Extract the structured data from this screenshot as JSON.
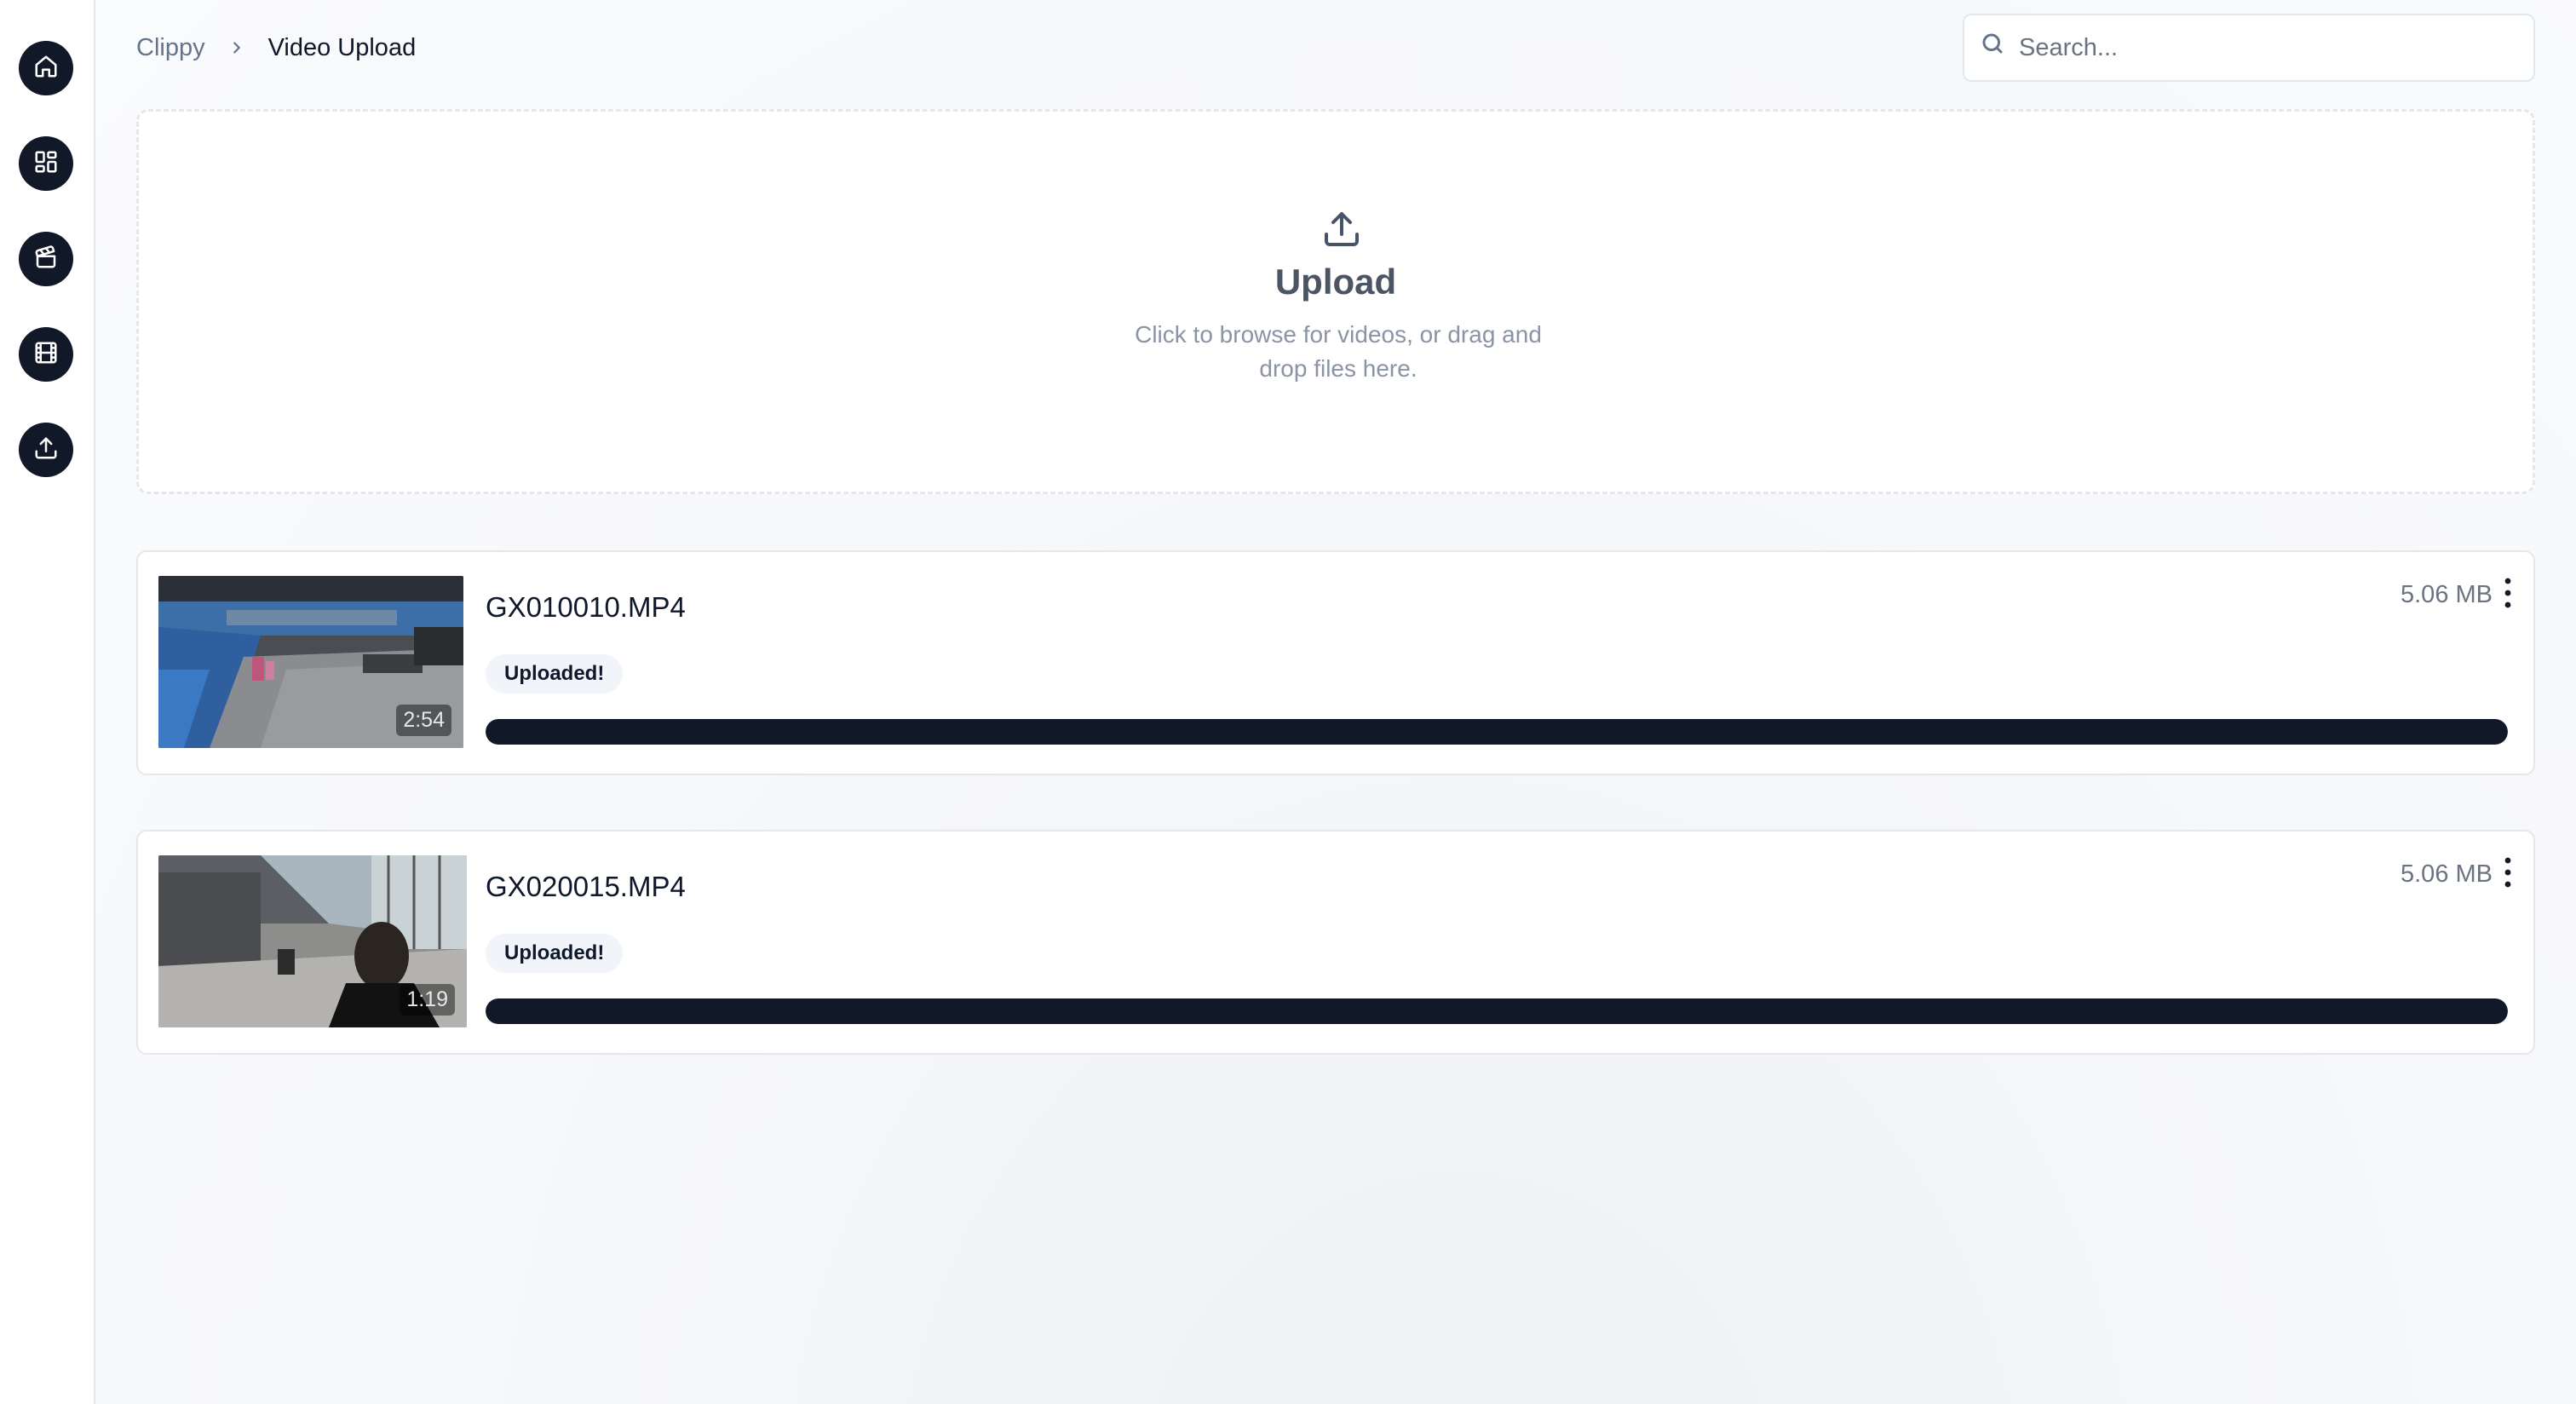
{
  "sidebar": {
    "items": [
      {
        "name": "home",
        "icon": "home-icon"
      },
      {
        "name": "dashboard",
        "icon": "layout-grid-icon"
      },
      {
        "name": "clapperboard",
        "icon": "clapperboard-icon"
      },
      {
        "name": "film",
        "icon": "film-icon"
      },
      {
        "name": "upload",
        "icon": "upload-icon"
      }
    ]
  },
  "breadcrumb": {
    "root": "Clippy",
    "separator_icon": "chevron-right-icon",
    "current": "Video Upload"
  },
  "search": {
    "placeholder": "Search...",
    "value": "",
    "icon": "search-icon"
  },
  "dropzone": {
    "icon": "upload-icon",
    "title": "Upload",
    "subtitle": "Click to browse for videos, or drag and drop files here."
  },
  "uploads": [
    {
      "filename": "GX010010.MP4",
      "duration": "2:54",
      "status": "Uploaded!",
      "size": "5.06 MB",
      "progress_percent": 100
    },
    {
      "filename": "GX020015.MP4",
      "duration": "1:19",
      "status": "Uploaded!",
      "size": "5.06 MB",
      "progress_percent": 100
    }
  ],
  "colors": {
    "accent": "#111827",
    "badge_bg": "#f1f5f9",
    "muted_text": "#6b7280"
  }
}
